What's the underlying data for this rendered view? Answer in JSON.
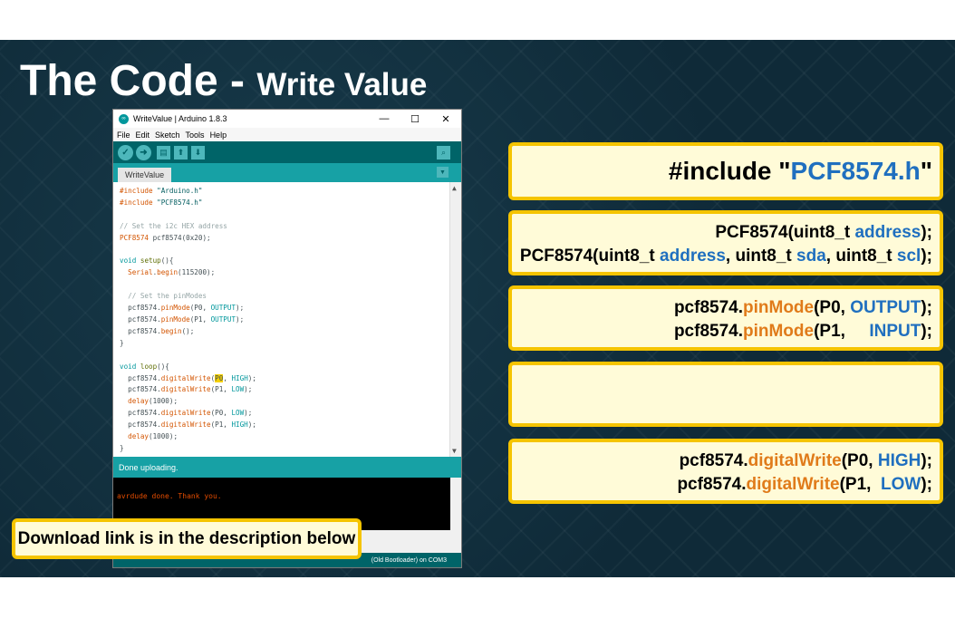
{
  "slide": {
    "title_main": "The Code",
    "title_sep": " - ",
    "title_sub": "Write Value"
  },
  "ide": {
    "window_title": "WriteValue | Arduino 1.8.3",
    "window_controls": {
      "minimize": "—",
      "maximize": "☐",
      "close": "✕"
    },
    "menu": [
      "File",
      "Edit",
      "Sketch",
      "Tools",
      "Help"
    ],
    "toolbar_icons": [
      "verify-icon",
      "upload-icon",
      "new-icon",
      "open-icon",
      "save-icon",
      "serial-monitor-icon"
    ],
    "toolbar_glyphs": {
      "verify": "✓",
      "upload": "➜",
      "new": "▤",
      "open": "⬆",
      "save": "⬇",
      "serial": "⌕"
    },
    "tab": "WriteValue",
    "tab_menu_glyph": "▼",
    "code": {
      "l1_kw": "#include",
      "l1_str": " \"Arduino.h\"",
      "l2_kw": "#include",
      "l2_str": " \"PCF8574.h\"",
      "l3": "// Set the i2c HEX address",
      "l4_type": "PCF8574",
      "l4_rest": " pcf8574(0x20);",
      "l5_kw": "void",
      "l5_fn": " setup",
      "l5_rest": "(){",
      "l6_obj": "  Serial",
      "l6_dot": ".",
      "l6_fn": "begin",
      "l6_rest": "(115200);",
      "l7": "  // Set the pinModes",
      "l8_obj": "  pcf8574.",
      "l8_fn": "pinMode",
      "l8_a": "(P0, ",
      "l8_c": "OUTPUT",
      "l8_e": ");",
      "l9_obj": "  pcf8574.",
      "l9_fn": "pinMode",
      "l9_a": "(P1, ",
      "l9_c": "OUTPUT",
      "l9_e": ");",
      "l10_obj": "  pcf8574.",
      "l10_fn": "begin",
      "l10_e": "();",
      "l11": "}",
      "l12_kw": "void",
      "l12_fn": " loop",
      "l12_rest": "(){",
      "l13_obj": "  pcf8574.",
      "l13_fn": "digitalWrite",
      "l13_a": "(",
      "l13_hl": "P0",
      "l13_b": ", ",
      "l13_c": "HIGH",
      "l13_e": ");",
      "l14_obj": "  pcf8574.",
      "l14_fn": "digitalWrite",
      "l14_a": "(P1, ",
      "l14_c": "LOW",
      "l14_e": ");",
      "l15_fn": "  delay",
      "l15_e": "(1000);",
      "l16_obj": "  pcf8574.",
      "l16_fn": "digitalWrite",
      "l16_a": "(P0, ",
      "l16_c": "LOW",
      "l16_e": ");",
      "l17_obj": "  pcf8574.",
      "l17_fn": "digitalWrite",
      "l17_a": "(P1, ",
      "l17_c": "HIGH",
      "l17_e": ");",
      "l18_fn": "  delay",
      "l18_e": "(1000);",
      "l19": "}"
    },
    "status": "Done uploading.",
    "console_line": "avrdude done.  Thank you.",
    "footer": "(Old Bootloader) on COM3",
    "scroll_glyphs": {
      "up": "▲",
      "down": "▼"
    }
  },
  "callouts": {
    "c1": {
      "pre": "#include \"",
      "blue": "PCF8574.h",
      "post": "\""
    },
    "c2": {
      "line1_pre": "PCF8574(uint8_t ",
      "line1_blue": "address",
      "line1_post": ");",
      "line2_pre": "PCF8574(uint8_t ",
      "line2_blue1": "address",
      "line2_mid1": ", uint8_t ",
      "line2_blue2": "sda",
      "line2_mid2": ", uint8_t ",
      "line2_blue3": "scl",
      "line2_post": ");"
    },
    "c3": {
      "line1_obj": "pcf8574.",
      "line1_fn": "pinMode",
      "line1_arg": "(P0, ",
      "line1_const": "OUTPUT",
      "line1_end": ");",
      "line2_obj": "pcf8574.",
      "line2_fn": "pinMode",
      "line2_arg": "(P1,     ",
      "line2_const": "INPUT",
      "line2_end": ");"
    },
    "c5": {
      "line1_obj": "pcf8574.",
      "line1_fn": "digitalWrite",
      "line1_arg": "(P0, ",
      "line1_const": "HIGH",
      "line1_end": ");",
      "line2_obj": "pcf8574.",
      "line2_fn": "digitalWrite",
      "line2_arg": "(P1,  ",
      "line2_const": "LOW",
      "line2_end": ");"
    },
    "download": "Download link is in the description below"
  },
  "colors": {
    "accent_teal": "#00979c",
    "callout_border": "#f5c400",
    "highlight_blue": "#1f6fbf",
    "highlight_orange": "#e07b1a"
  }
}
